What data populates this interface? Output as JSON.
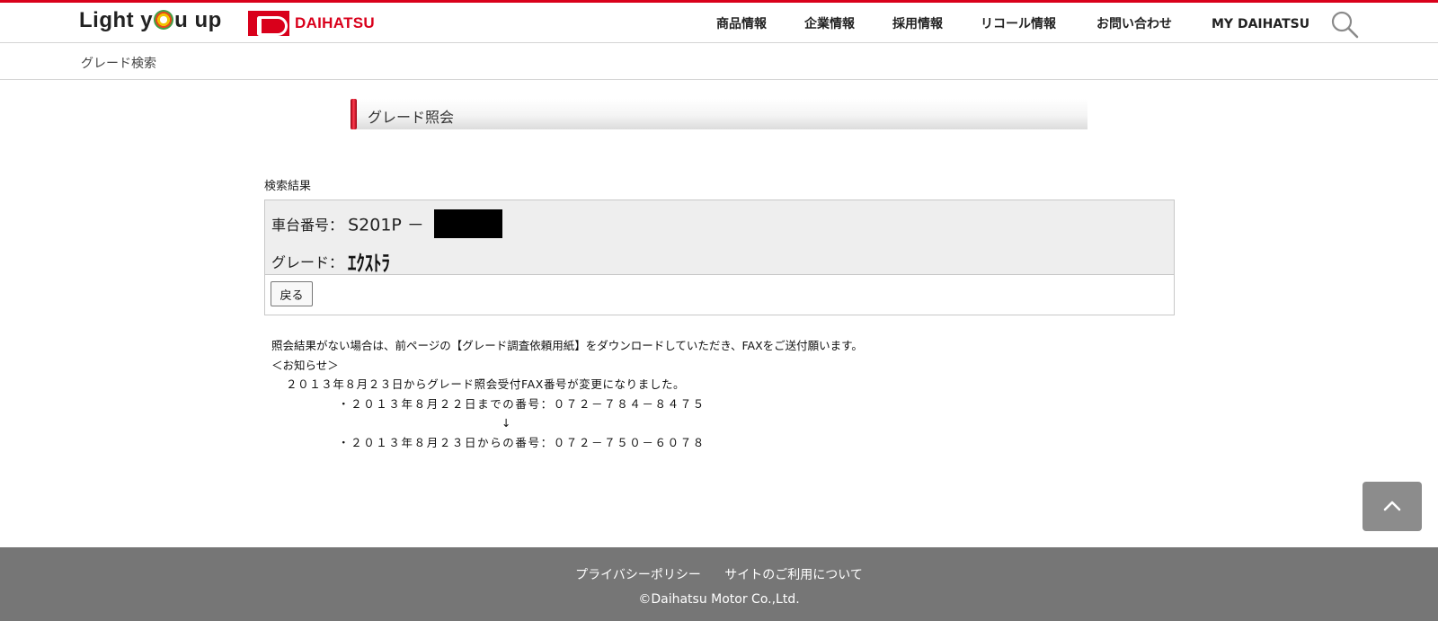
{
  "header": {
    "logo_light_before": "Light y",
    "logo_light_after": "u up",
    "logo_brand": "DAIHATSU",
    "nav": [
      {
        "label": "商品情報"
      },
      {
        "label": "企業情報"
      },
      {
        "label": "採用情報"
      },
      {
        "label": "リコール情報"
      },
      {
        "label": "お問い合わせ"
      },
      {
        "label": "MY DAIHATSU"
      }
    ],
    "search_icon": "search-icon"
  },
  "breadcrumb": "グレード検索",
  "page_title": "グレード照会",
  "results": {
    "section_label": "検索結果",
    "chassis_label": "車台番号：",
    "chassis_value": "S201P －",
    "grade_label": "グレード：",
    "grade_value": "ｴｸｽﾄﾗ",
    "back_label": "戻る"
  },
  "notice": {
    "line1": "照会結果がない場合は、前ページの【グレード調査依頼用紙】をダウンロードしていただき、FAXをご送付願います。",
    "line2": "＜お知らせ＞",
    "line3": "２０１３年８月２３日からグレード照会受付FAX番号が変更になりました。",
    "line4": "・２０１３年８月２２日までの番号：０７２－７８４－８４７５",
    "arrow": "↓",
    "line5": "・２０１３年８月２３日からの番号：０７２－７５０－６０７８"
  },
  "footer": {
    "links": [
      "プライバシーポリシー",
      "サイトのご利用について"
    ],
    "copyright": "©Daihatsu Motor Co.,Ltd."
  },
  "colors": {
    "brand_red": "#d9001b",
    "footer_bg": "#767676",
    "result_bg": "#eeeeee",
    "scroll_top_bg": "#8c8c8c"
  }
}
